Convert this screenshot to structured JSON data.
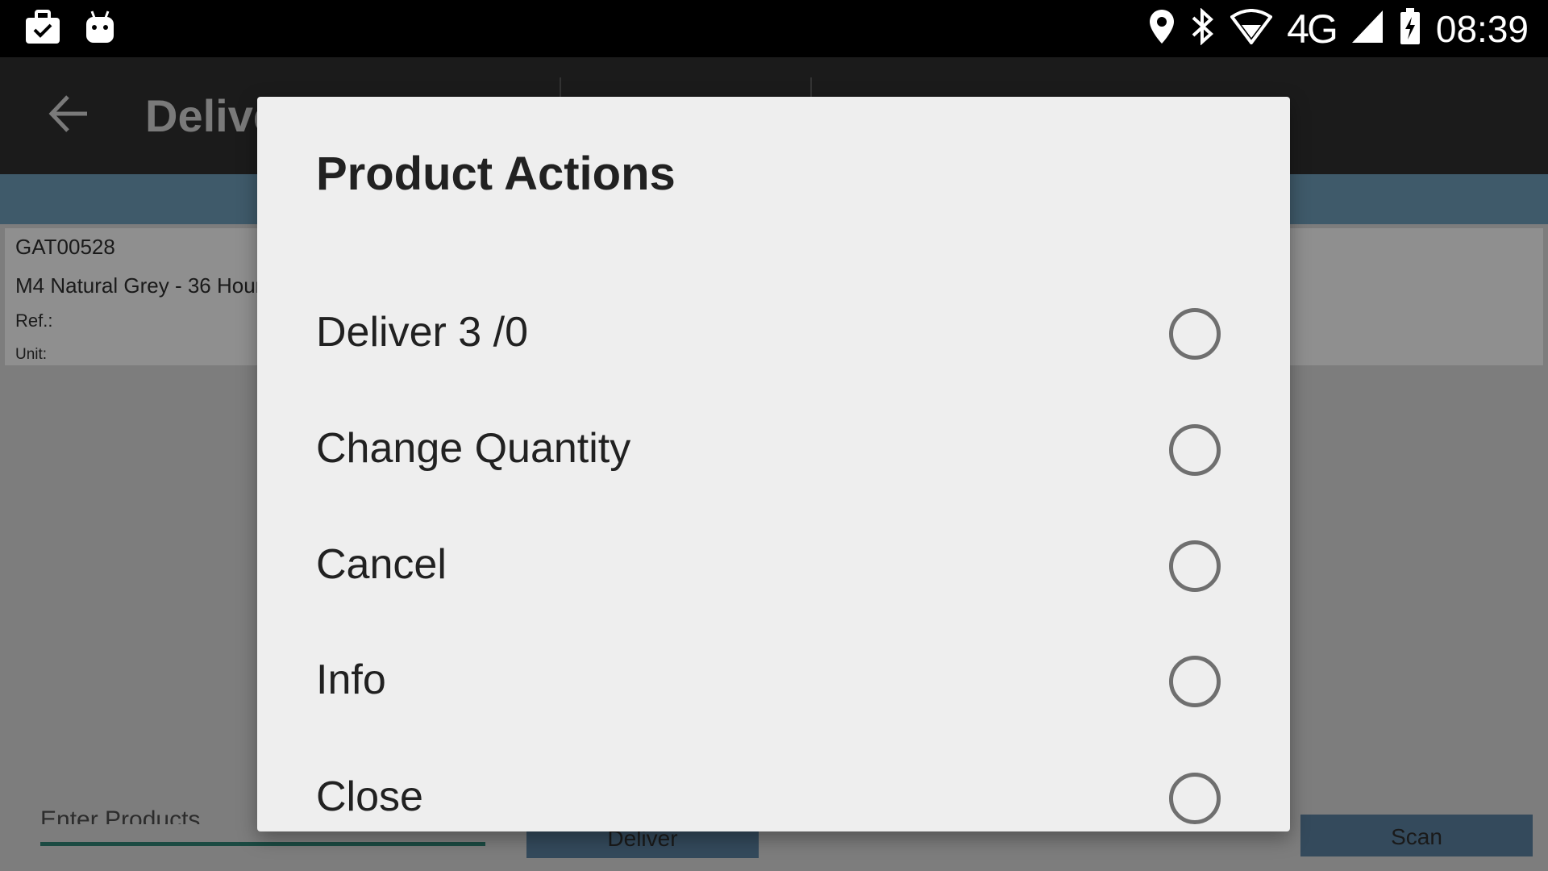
{
  "status_bar": {
    "time": "08:39",
    "network": "4G",
    "left_icons": [
      "briefcase-check-icon",
      "android-debug-icon"
    ],
    "right_icons": [
      "location-pin-icon",
      "bluetooth-icon",
      "wifi-icon",
      "cell-signal-icon",
      "battery-charging-icon"
    ]
  },
  "app": {
    "title": "Delive",
    "product": {
      "code": "GAT00528",
      "name": "M4 Natural Grey - 36 Hour",
      "ref_label": "Ref.:",
      "unit_label": "Unit:"
    },
    "enter_products_placeholder": "Enter Products",
    "deliver_button": "Deliver",
    "scan_button": "Scan"
  },
  "dialog": {
    "title": "Product Actions",
    "options": [
      {
        "label": "Deliver 3 /0",
        "selected": false
      },
      {
        "label": "Change Quantity",
        "selected": false
      },
      {
        "label": "Cancel",
        "selected": false
      },
      {
        "label": "Info",
        "selected": false
      },
      {
        "label": "Close",
        "selected": false
      }
    ]
  },
  "colors": {
    "status_bar": "#000000",
    "app_bar": "#1b1b1b",
    "accent_strip": "#3f5a6a",
    "dialog_bg": "#eeeeee",
    "button_bg": "#344a5c",
    "scrim": "#7d7d7d"
  }
}
